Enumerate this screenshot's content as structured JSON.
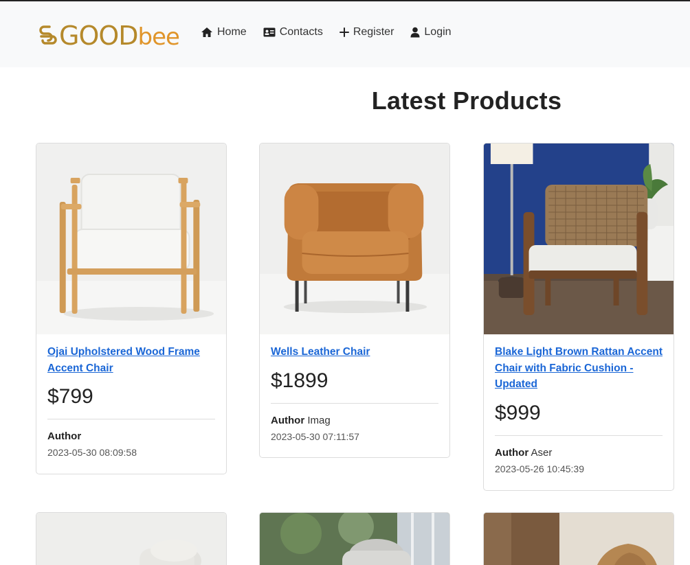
{
  "brand": {
    "name_left": "GOOD",
    "name_right": "bee",
    "colors": {
      "gold": "#b5892b",
      "orange": "#e0952a"
    }
  },
  "nav": {
    "items": [
      {
        "label": "Home",
        "icon": "home-icon"
      },
      {
        "label": "Contacts",
        "icon": "contact-card-icon"
      },
      {
        "label": "Register",
        "icon": "plus-icon"
      },
      {
        "label": "Login",
        "icon": "user-icon"
      }
    ]
  },
  "page": {
    "title": "Latest Products"
  },
  "products": [
    {
      "title": "Ojai Upholstered Wood Frame Accent Chair",
      "price": "$799",
      "author_label": "Author",
      "author_name": "",
      "date": "2023-05-30 08:09:58"
    },
    {
      "title": "Wells Leather Chair",
      "price": "$1899",
      "author_label": "Author",
      "author_name": "Imag",
      "date": "2023-05-30 07:11:57"
    },
    {
      "title": "Blake Light Brown Rattan Accent Chair with Fabric Cushion - Updated",
      "price": "$999",
      "author_label": "Author",
      "author_name": "Aser",
      "date": "2023-05-26 10:45:39"
    }
  ],
  "colors": {
    "link": "#1a66d6",
    "navbar_bg": "#f8f9fa"
  }
}
